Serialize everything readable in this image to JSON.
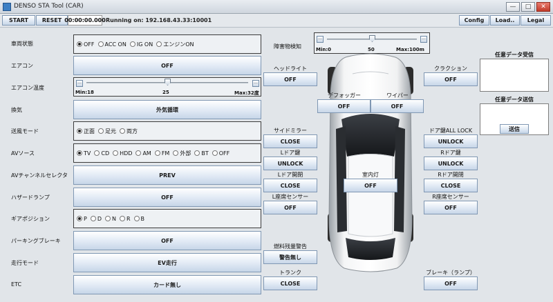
{
  "window": {
    "title": "DENSO STA Tool (CAR)",
    "minimize": "—",
    "maximize": "□",
    "close": "✕"
  },
  "toolbar": {
    "start": "START",
    "reset": "RESET",
    "timer": "00:00:00.000",
    "status": "Running on: 192.168.43.33:10001",
    "config": "Config",
    "load": "Load..",
    "legal": "Legal"
  },
  "vehicle_state": {
    "label": "車両状態",
    "options": [
      "OFF",
      "ACC ON",
      "IG ON",
      "エンジンON"
    ],
    "selected": "OFF"
  },
  "aircon": {
    "label": "エアコン",
    "value": "OFF"
  },
  "aircon_temp": {
    "label": "エアコン温度",
    "min_label": "Min:18",
    "max_label": "Max:32度",
    "value": "25",
    "min": 18,
    "max": 32,
    "current": 25
  },
  "ventilation": {
    "label": "換気",
    "value": "外気循環"
  },
  "airflow_mode": {
    "label": "送風モード",
    "options": [
      "正面",
      "足元",
      "両方"
    ],
    "selected": "正面"
  },
  "av_source": {
    "label": "AVソース",
    "options": [
      "TV",
      "CD",
      "HDD",
      "AM",
      "FM",
      "外部",
      "BT",
      "OFF"
    ],
    "selected": "TV"
  },
  "av_channel": {
    "label": "AVチャンネルセレクタ",
    "value": "PREV"
  },
  "hazard": {
    "label": "ハザードランプ",
    "value": "OFF"
  },
  "gear": {
    "label": "ギアポジション",
    "options": [
      "P",
      "D",
      "N",
      "R",
      "B"
    ],
    "selected": "P"
  },
  "parking_brake": {
    "label": "パーキングブレーキ",
    "value": "OFF"
  },
  "drive_mode": {
    "label": "走行モード",
    "value": "EV走行"
  },
  "etc": {
    "label": "ETC",
    "value": "カード無し"
  },
  "obstacle": {
    "label": "障害物検知",
    "min_label": "Min:0",
    "max_label": "Max:100m",
    "value": "50",
    "min": 0,
    "max": 100,
    "current": 50
  },
  "headlight": {
    "label": "ヘッドライト",
    "value": "OFF"
  },
  "horn": {
    "label": "クラクション",
    "value": "OFF"
  },
  "defogger": {
    "label": "デフォッガー",
    "value": "OFF"
  },
  "wiper": {
    "label": "ワイパー",
    "value": "OFF"
  },
  "side_mirror": {
    "label": "サイドミラー",
    "value": "CLOSE"
  },
  "door_lock_all": {
    "label": "ドア鍵ALL LOCK",
    "value": "UNLOCK"
  },
  "left_door_key": {
    "label": "Lドア鍵",
    "value": "UNLOCK"
  },
  "right_door_key": {
    "label": "Rドア鍵",
    "value": "UNLOCK"
  },
  "left_door_open": {
    "label": "Lドア開閉",
    "value": "CLOSE"
  },
  "right_door_open": {
    "label": "Rドア開閉",
    "value": "CLOSE"
  },
  "room_light": {
    "label": "室内灯",
    "value": "OFF"
  },
  "left_seat_sensor": {
    "label": "L座席センサー",
    "value": "OFF"
  },
  "right_seat_sensor": {
    "label": "R座席センサー",
    "value": "OFF"
  },
  "fuel_warning": {
    "label": "燃料残量警告",
    "value": "警告無し"
  },
  "trunk": {
    "label": "トランク",
    "value": "CLOSE"
  },
  "brake_lamp": {
    "label": "ブレーキ（ランプ）",
    "value": "OFF"
  },
  "any_receive": {
    "label": "任意データ受信"
  },
  "any_send": {
    "label": "任意データ送信",
    "button": "送信"
  }
}
